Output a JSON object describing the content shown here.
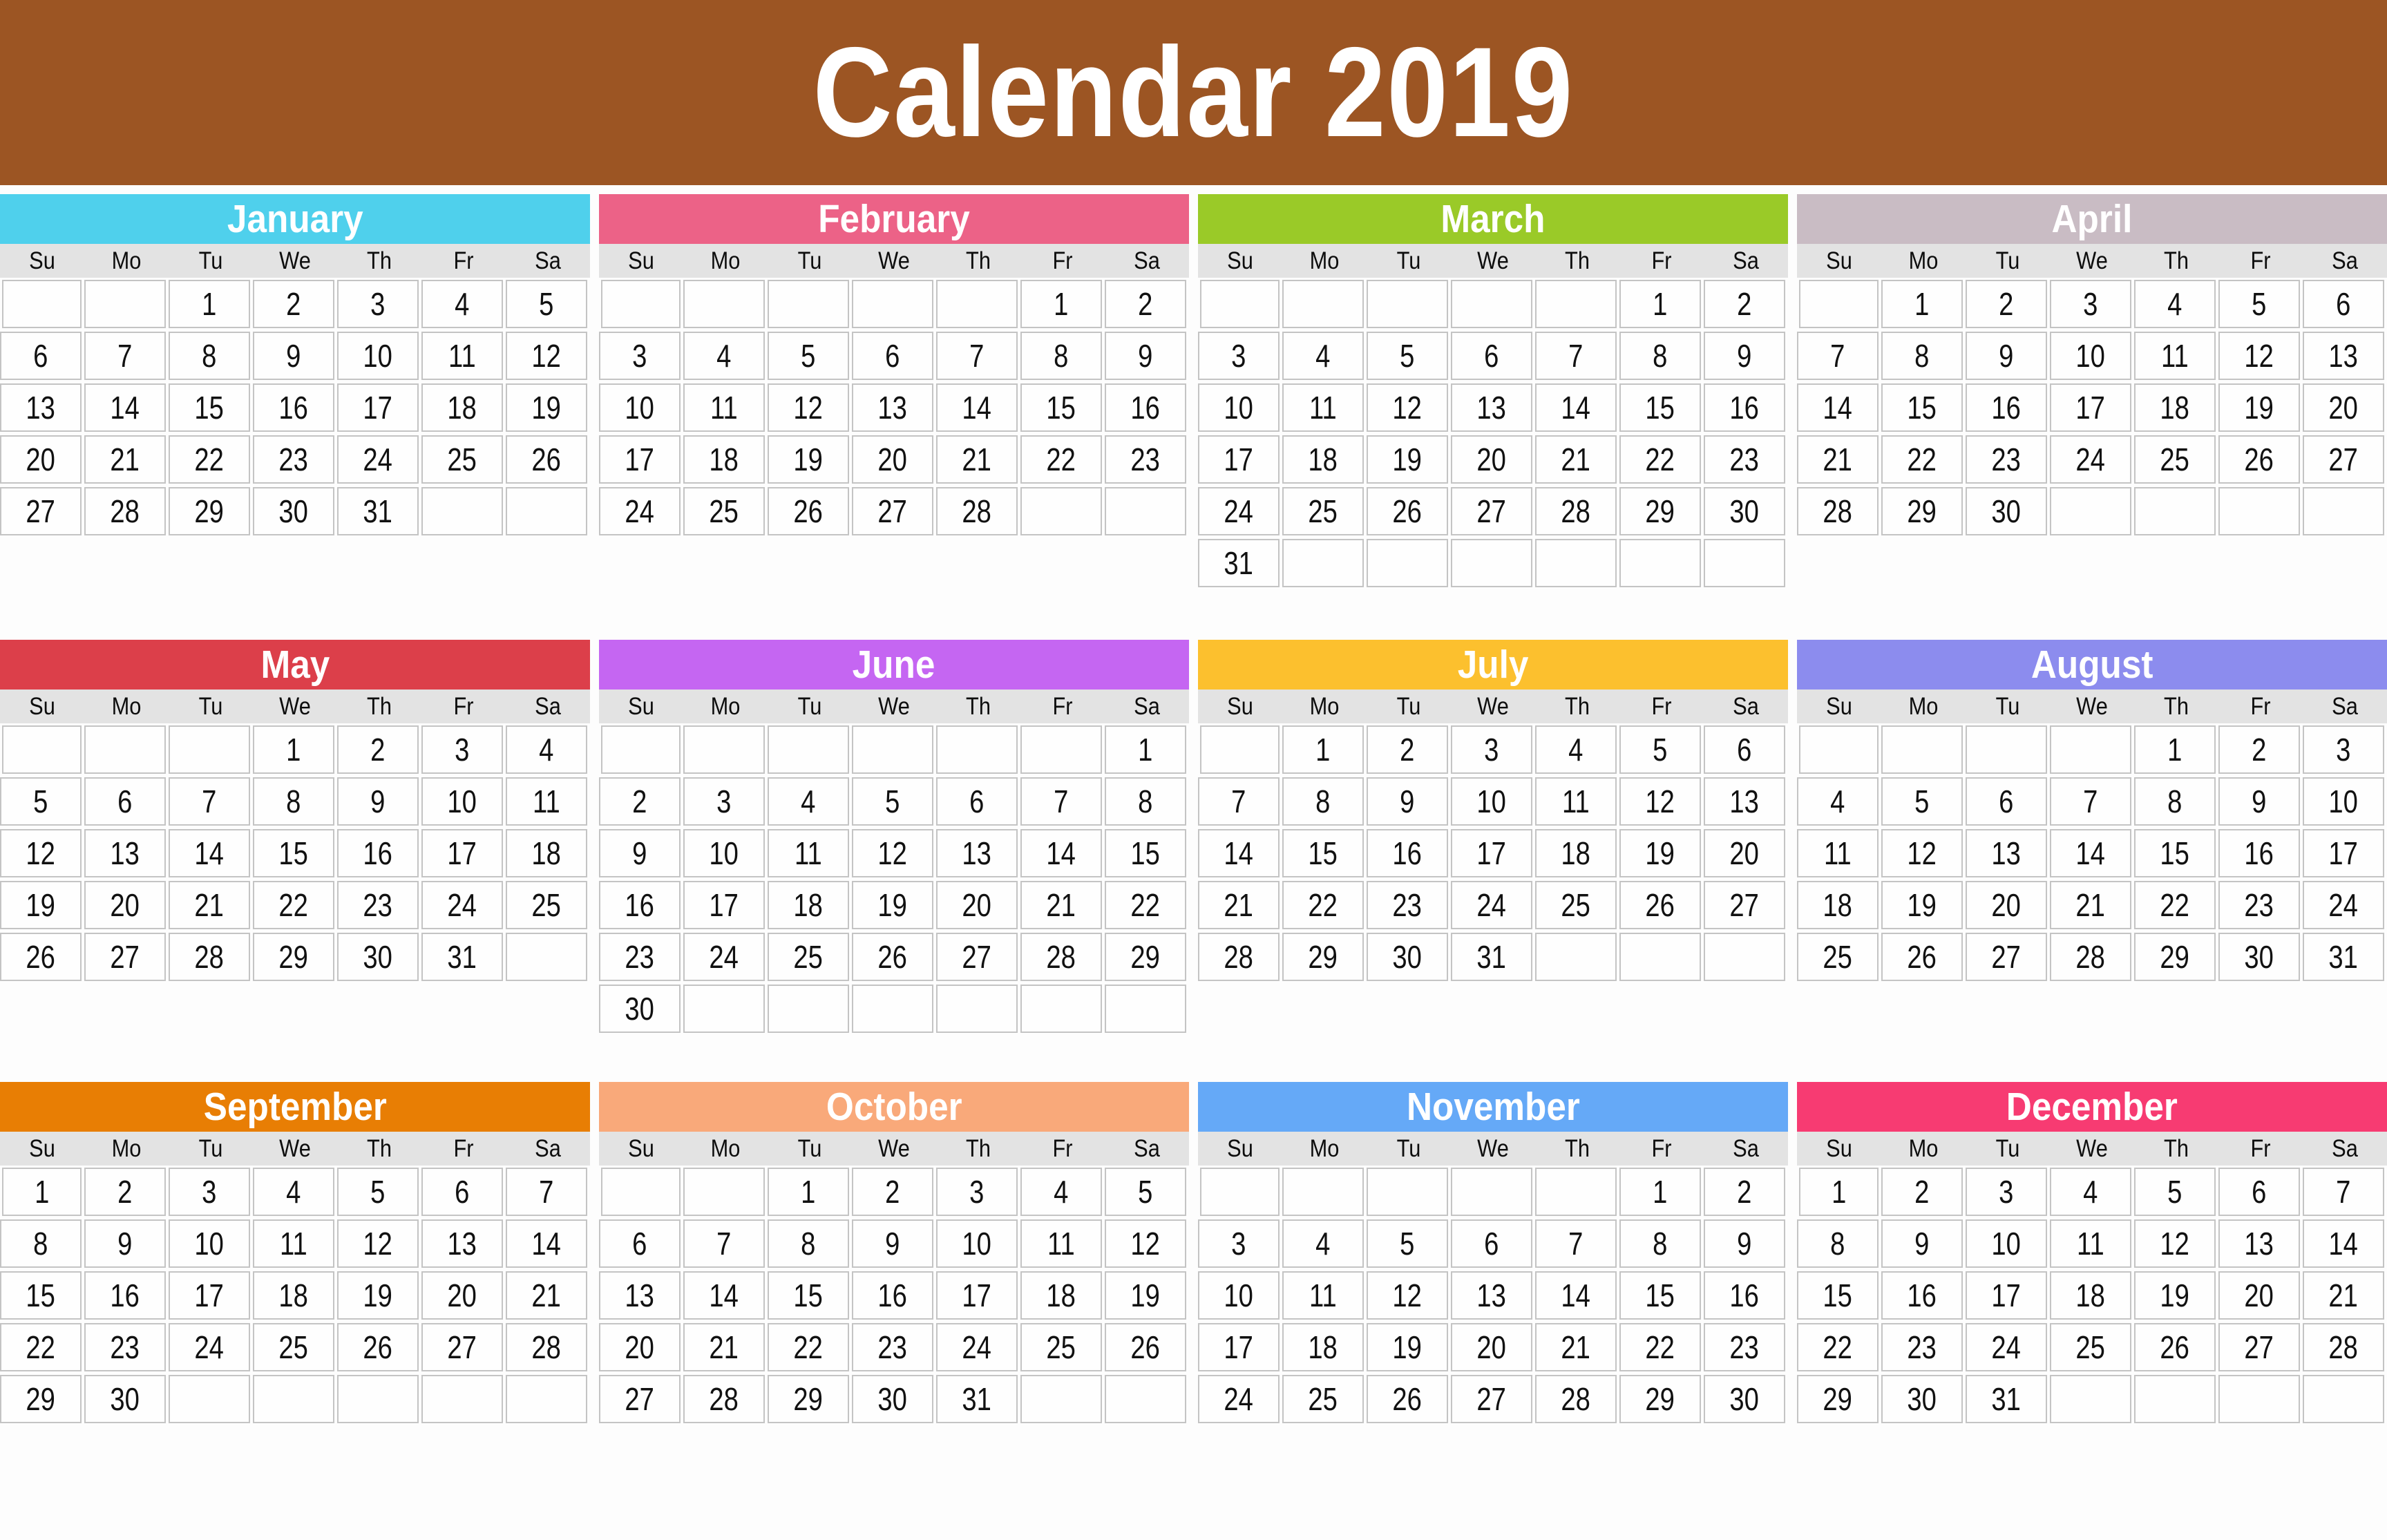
{
  "header": {
    "title": "Calendar 2019",
    "background_color": "#9C5523",
    "text_color": "#FFFFFF"
  },
  "weekday_labels": [
    "Su",
    "Mo",
    "Tu",
    "We",
    "Th",
    "Fr",
    "Sa"
  ],
  "weekday_row_background": "#E3E3E3",
  "day_cell_border_color": "#C4C4C4",
  "page_background": "#FDFDFD",
  "year": "2019",
  "months": [
    {
      "name": "January",
      "header_color": "#4FD0EC",
      "start_weekday_index": 2,
      "num_days": 31,
      "weeks": [
        [
          "",
          "",
          "1",
          "2",
          "3",
          "4",
          "5"
        ],
        [
          "6",
          "7",
          "8",
          "9",
          "10",
          "11",
          "12"
        ],
        [
          "13",
          "14",
          "15",
          "16",
          "17",
          "18",
          "19"
        ],
        [
          "20",
          "21",
          "22",
          "23",
          "24",
          "25",
          "26"
        ],
        [
          "27",
          "28",
          "29",
          "30",
          "31",
          "",
          ""
        ]
      ]
    },
    {
      "name": "February",
      "header_color": "#EC6287",
      "start_weekday_index": 5,
      "num_days": 28,
      "weeks": [
        [
          "",
          "",
          "",
          "",
          "",
          "1",
          "2"
        ],
        [
          "3",
          "4",
          "5",
          "6",
          "7",
          "8",
          "9"
        ],
        [
          "10",
          "11",
          "12",
          "13",
          "14",
          "15",
          "16"
        ],
        [
          "17",
          "18",
          "19",
          "20",
          "21",
          "22",
          "23"
        ],
        [
          "24",
          "25",
          "26",
          "27",
          "28",
          "",
          ""
        ]
      ]
    },
    {
      "name": "March",
      "header_color": "#9ACA28",
      "start_weekday_index": 5,
      "num_days": 31,
      "weeks": [
        [
          "",
          "",
          "",
          "",
          "",
          "1",
          "2"
        ],
        [
          "3",
          "4",
          "5",
          "6",
          "7",
          "8",
          "9"
        ],
        [
          "10",
          "11",
          "12",
          "13",
          "14",
          "15",
          "16"
        ],
        [
          "17",
          "18",
          "19",
          "20",
          "21",
          "22",
          "23"
        ],
        [
          "24",
          "25",
          "26",
          "27",
          "28",
          "29",
          "30"
        ],
        [
          "31",
          "",
          "",
          "",
          "",
          "",
          ""
        ]
      ]
    },
    {
      "name": "April",
      "header_color": "#C9BCC4",
      "start_weekday_index": 1,
      "num_days": 30,
      "weeks": [
        [
          "",
          "1",
          "2",
          "3",
          "4",
          "5",
          "6"
        ],
        [
          "7",
          "8",
          "9",
          "10",
          "11",
          "12",
          "13"
        ],
        [
          "14",
          "15",
          "16",
          "17",
          "18",
          "19",
          "20"
        ],
        [
          "21",
          "22",
          "23",
          "24",
          "25",
          "26",
          "27"
        ],
        [
          "28",
          "29",
          "30",
          "",
          "",
          "",
          ""
        ]
      ]
    },
    {
      "name": "May",
      "header_color": "#DC3F4A",
      "start_weekday_index": 3,
      "num_days": 31,
      "weeks": [
        [
          "",
          "",
          "",
          "1",
          "2",
          "3",
          "4"
        ],
        [
          "5",
          "6",
          "7",
          "8",
          "9",
          "10",
          "11"
        ],
        [
          "12",
          "13",
          "14",
          "15",
          "16",
          "17",
          "18"
        ],
        [
          "19",
          "20",
          "21",
          "22",
          "23",
          "24",
          "25"
        ],
        [
          "26",
          "27",
          "28",
          "29",
          "30",
          "31",
          ""
        ]
      ]
    },
    {
      "name": "June",
      "header_color": "#C566F2",
      "start_weekday_index": 6,
      "num_days": 30,
      "weeks": [
        [
          "",
          "",
          "",
          "",
          "",
          "",
          "1"
        ],
        [
          "2",
          "3",
          "4",
          "5",
          "6",
          "7",
          "8"
        ],
        [
          "9",
          "10",
          "11",
          "12",
          "13",
          "14",
          "15"
        ],
        [
          "16",
          "17",
          "18",
          "19",
          "20",
          "21",
          "22"
        ],
        [
          "23",
          "24",
          "25",
          "26",
          "27",
          "28",
          "29"
        ],
        [
          "30",
          "",
          "",
          "",
          "",
          "",
          ""
        ]
      ]
    },
    {
      "name": "July",
      "header_color": "#FCC02E",
      "start_weekday_index": 1,
      "num_days": 31,
      "weeks": [
        [
          "",
          "1",
          "2",
          "3",
          "4",
          "5",
          "6"
        ],
        [
          "7",
          "8",
          "9",
          "10",
          "11",
          "12",
          "13"
        ],
        [
          "14",
          "15",
          "16",
          "17",
          "18",
          "19",
          "20"
        ],
        [
          "21",
          "22",
          "23",
          "24",
          "25",
          "26",
          "27"
        ],
        [
          "28",
          "29",
          "30",
          "31",
          "",
          "",
          ""
        ]
      ]
    },
    {
      "name": "August",
      "header_color": "#8C8CEE",
      "start_weekday_index": 4,
      "num_days": 31,
      "weeks": [
        [
          "",
          "",
          "",
          "",
          "1",
          "2",
          "3"
        ],
        [
          "4",
          "5",
          "6",
          "7",
          "8",
          "9",
          "10"
        ],
        [
          "11",
          "12",
          "13",
          "14",
          "15",
          "16",
          "17"
        ],
        [
          "18",
          "19",
          "20",
          "21",
          "22",
          "23",
          "24"
        ],
        [
          "25",
          "26",
          "27",
          "28",
          "29",
          "30",
          "31"
        ]
      ]
    },
    {
      "name": "September",
      "header_color": "#E87E04",
      "start_weekday_index": 0,
      "num_days": 30,
      "weeks": [
        [
          "1",
          "2",
          "3",
          "4",
          "5",
          "6",
          "7"
        ],
        [
          "8",
          "9",
          "10",
          "11",
          "12",
          "13",
          "14"
        ],
        [
          "15",
          "16",
          "17",
          "18",
          "19",
          "20",
          "21"
        ],
        [
          "22",
          "23",
          "24",
          "25",
          "26",
          "27",
          "28"
        ],
        [
          "29",
          "30",
          "",
          "",
          "",
          "",
          ""
        ]
      ]
    },
    {
      "name": "October",
      "header_color": "#F9A97A",
      "start_weekday_index": 2,
      "num_days": 31,
      "weeks": [
        [
          "",
          "",
          "1",
          "2",
          "3",
          "4",
          "5"
        ],
        [
          "6",
          "7",
          "8",
          "9",
          "10",
          "11",
          "12"
        ],
        [
          "13",
          "14",
          "15",
          "16",
          "17",
          "18",
          "19"
        ],
        [
          "20",
          "21",
          "22",
          "23",
          "24",
          "25",
          "26"
        ],
        [
          "27",
          "28",
          "29",
          "30",
          "31",
          "",
          ""
        ]
      ]
    },
    {
      "name": "November",
      "header_color": "#65A9F7",
      "start_weekday_index": 5,
      "num_days": 30,
      "weeks": [
        [
          "",
          "",
          "",
          "",
          "",
          "1",
          "2"
        ],
        [
          "3",
          "4",
          "5",
          "6",
          "7",
          "8",
          "9"
        ],
        [
          "10",
          "11",
          "12",
          "13",
          "14",
          "15",
          "16"
        ],
        [
          "17",
          "18",
          "19",
          "20",
          "21",
          "22",
          "23"
        ],
        [
          "24",
          "25",
          "26",
          "27",
          "28",
          "29",
          "30"
        ]
      ]
    },
    {
      "name": "December",
      "header_color": "#F73B72",
      "start_weekday_index": 0,
      "num_days": 31,
      "weeks": [
        [
          "1",
          "2",
          "3",
          "4",
          "5",
          "6",
          "7"
        ],
        [
          "8",
          "9",
          "10",
          "11",
          "12",
          "13",
          "14"
        ],
        [
          "15",
          "16",
          "17",
          "18",
          "19",
          "20",
          "21"
        ],
        [
          "22",
          "23",
          "24",
          "25",
          "26",
          "27",
          "28"
        ],
        [
          "29",
          "30",
          "31",
          "",
          "",
          "",
          ""
        ]
      ]
    }
  ]
}
